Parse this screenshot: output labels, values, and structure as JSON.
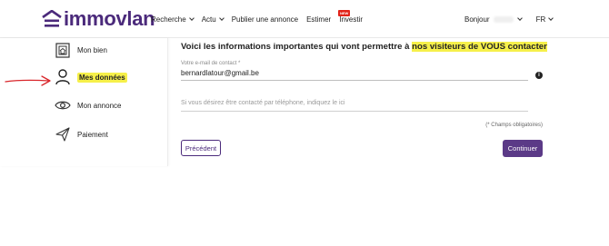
{
  "header": {
    "logo_text": "immovlan",
    "nav": [
      {
        "label": "Recherche",
        "has_dropdown": true
      },
      {
        "label": "Actu",
        "has_dropdown": true
      },
      {
        "label": "Publier une annonce",
        "has_dropdown": false
      },
      {
        "label": "Estimer",
        "has_dropdown": false
      },
      {
        "label": "Investir",
        "has_dropdown": false
      }
    ],
    "investir_badge": "NEW",
    "greeting": "Bonjour",
    "language": "FR",
    "brand_color": "#4b2a7b"
  },
  "sidebar": {
    "items": [
      {
        "label": "Mon bien",
        "icon": "property-icon",
        "active": false
      },
      {
        "label": "Mes données",
        "icon": "user-icon",
        "active": true
      },
      {
        "label": "Mon annonce",
        "icon": "eye-icon",
        "active": false
      },
      {
        "label": "Paiement",
        "icon": "send-icon",
        "active": false
      }
    ],
    "highlight_color": "#f6f04a"
  },
  "form": {
    "headline_start": "Voici les informations importantes qui vont permettre à ",
    "headline_highlight": "nos visiteurs de VOUS contacter",
    "email_label": "Votre e-mail de contact *",
    "email_value": "bernardlatour@gmail.be",
    "info_icon": "info-icon",
    "phone_placeholder": "Si vous désirez être contacté par téléphone, indiquez le ici",
    "required_note": "(* Champs obligatoires)",
    "prev_button": "Précédent",
    "next_button": "Continuer"
  },
  "annotation": {
    "arrow_color": "#d9262b"
  }
}
